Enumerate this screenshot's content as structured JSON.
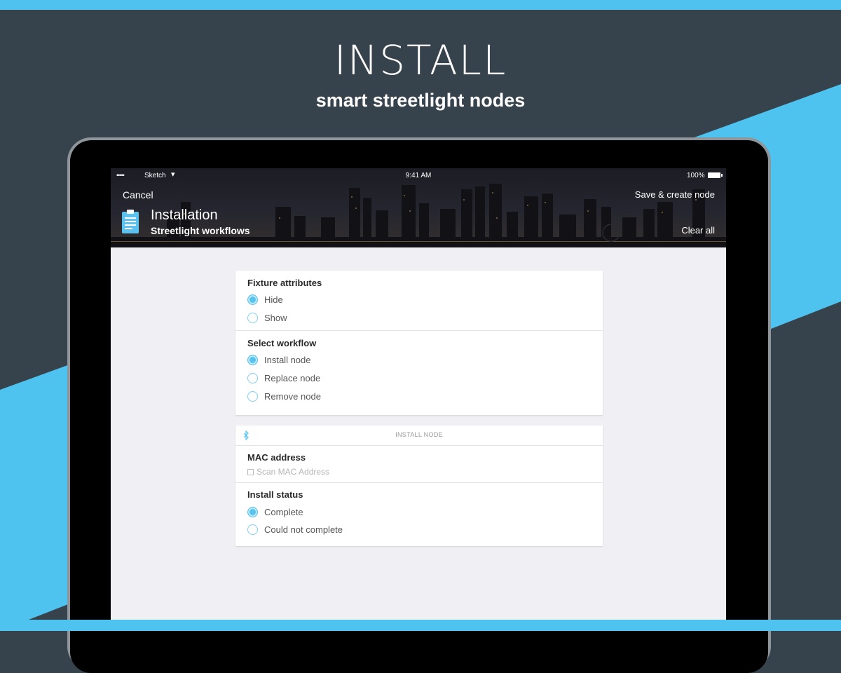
{
  "hero": {
    "title": "INSTALL",
    "subtitle": "smart streetlight nodes"
  },
  "statusbar": {
    "signal": "•••••",
    "carrier": "Sketch",
    "time": "9:41 AM",
    "battery": "100%"
  },
  "header": {
    "cancel_label": "Cancel",
    "save_label": "Save & create node",
    "title": "Installation",
    "subtitle": "Streetlight workflows",
    "clear_label": "Clear all"
  },
  "fixture_attributes": {
    "title": "Fixture attributes",
    "options": [
      {
        "label": "Hide",
        "selected": true
      },
      {
        "label": "Show",
        "selected": false
      }
    ]
  },
  "workflow": {
    "title": "Select workflow",
    "options": [
      {
        "label": "Install node",
        "selected": true
      },
      {
        "label": "Replace node",
        "selected": false
      },
      {
        "label": "Remove node",
        "selected": false
      }
    ]
  },
  "install_node": {
    "header": "INSTALL NODE",
    "mac_title": "MAC address",
    "mac_placeholder": "Scan MAC Address",
    "status_title": "Install status",
    "status_options": [
      {
        "label": "Complete",
        "selected": true
      },
      {
        "label": "Could not complete",
        "selected": false
      }
    ]
  },
  "colors": {
    "accent": "#57c3ef",
    "background": "#37434c",
    "screen": "#efeff4"
  },
  "icons": {
    "clipboard": "clipboard-icon",
    "bluetooth": "bluetooth-icon",
    "scan": "scan-icon",
    "wifi": "wifi-icon",
    "battery": "battery-icon"
  }
}
